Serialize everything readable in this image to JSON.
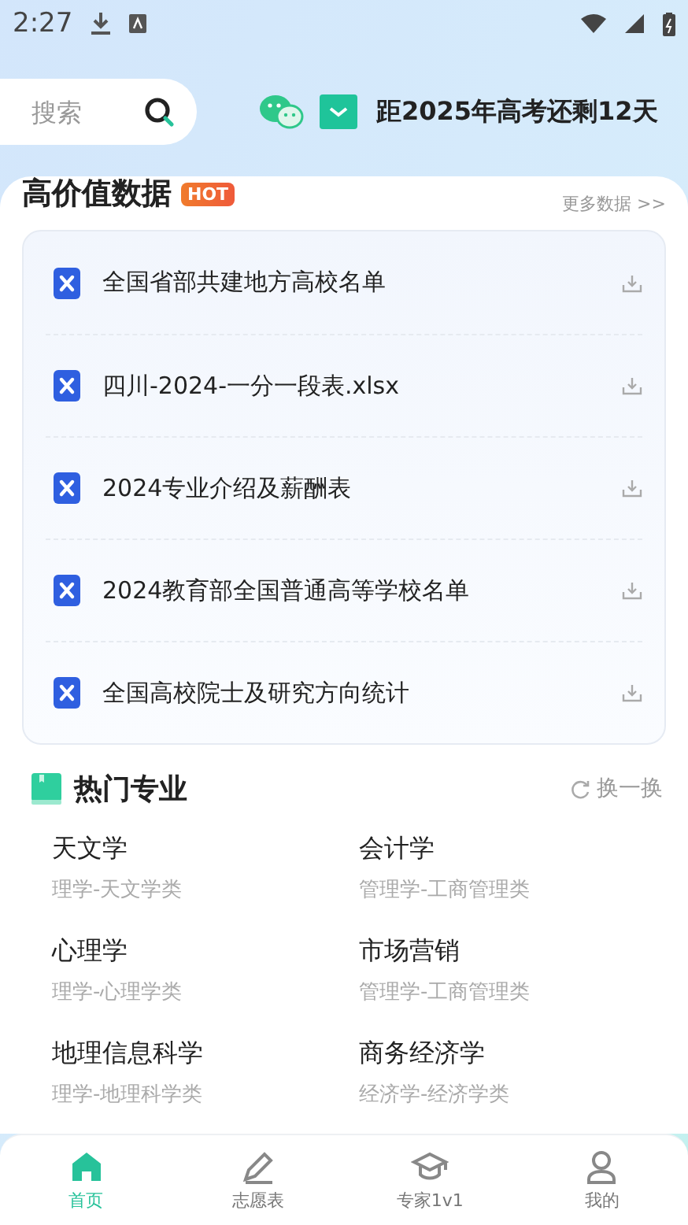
{
  "status_bar": {
    "time": "2:27"
  },
  "header": {
    "search": {
      "placeholder": "搜索"
    },
    "countdown": "距2025年高考还剩12天"
  },
  "data_section": {
    "title": "高价值数据",
    "badge": "HOT",
    "more": "更多数据 >>",
    "files": [
      {
        "name": "全国省部共建地方高校名单"
      },
      {
        "name": "四川-2024-一分一段表.xlsx"
      },
      {
        "name": "2024专业介绍及薪酬表"
      },
      {
        "name": "2024教育部全国普通高等学校名单"
      },
      {
        "name": "全国高校院士及研究方向统计"
      }
    ]
  },
  "majors_section": {
    "title": "热门专业",
    "refresh": "换一换",
    "majors": [
      {
        "name": "天文学",
        "category": "理学-天文学类"
      },
      {
        "name": "会计学",
        "category": "管理学-工商管理类"
      },
      {
        "name": "心理学",
        "category": "理学-心理学类"
      },
      {
        "name": "市场营销",
        "category": "管理学-工商管理类"
      },
      {
        "name": "地理信息科学",
        "category": "理学-地理科学类"
      },
      {
        "name": "商务经济学",
        "category": "经济学-经济学类"
      }
    ]
  },
  "tab_bar": [
    {
      "label": "首页",
      "selected": true
    },
    {
      "label": "志愿表",
      "selected": false
    },
    {
      "label": "专家1v1",
      "selected": false
    },
    {
      "label": "我的",
      "selected": false
    }
  ]
}
